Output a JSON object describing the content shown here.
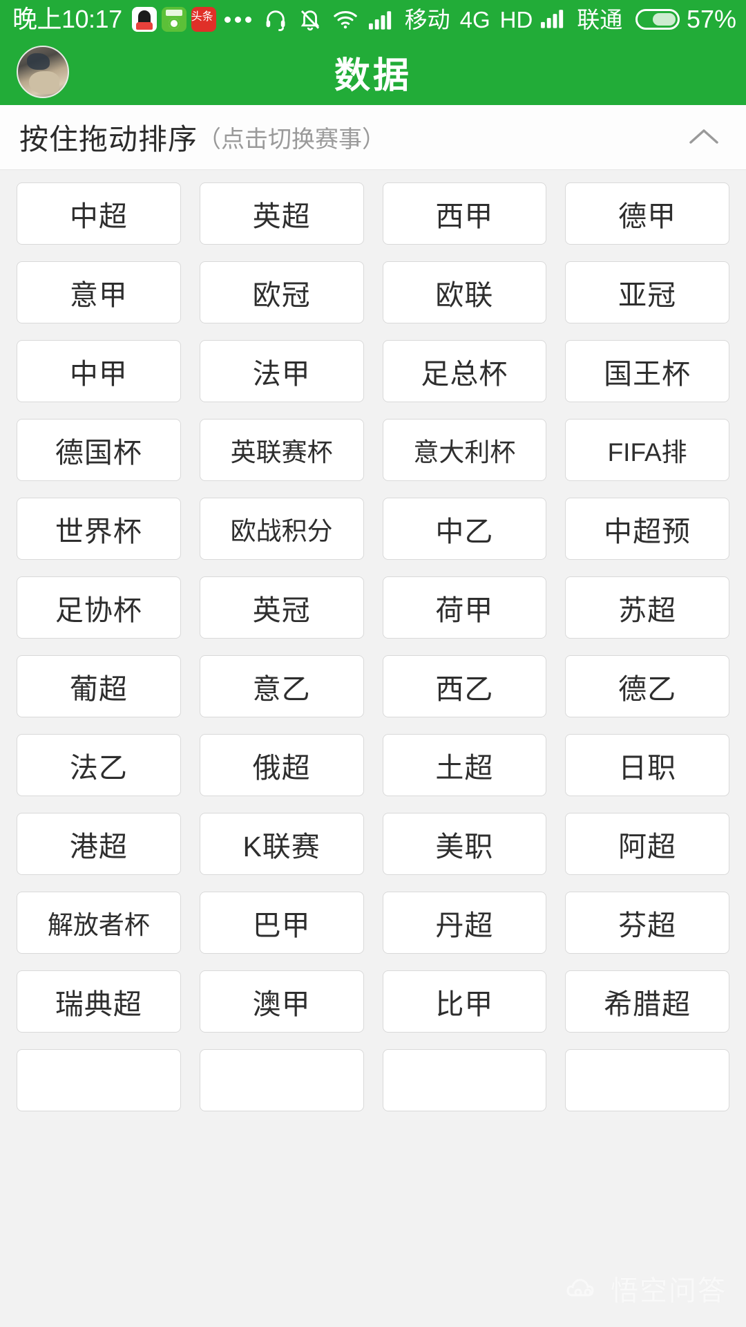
{
  "status_bar": {
    "clock": "晚上10:17",
    "app_icons": [
      {
        "name": "qq-icon",
        "label": ""
      },
      {
        "name": "football-app-icon",
        "label": ""
      },
      {
        "name": "toutiao-icon",
        "label": "头条"
      }
    ],
    "overflow_dots": "•••",
    "icons": [
      "headset-icon",
      "bell-muted-icon",
      "wifi-icon",
      "signal-bars-icon"
    ],
    "carrier_primary": "移动",
    "network_type": "4G",
    "hd_label": "HD",
    "carrier_secondary": "联通",
    "battery_percent": "57%"
  },
  "app_bar": {
    "title": "数据",
    "avatar_name": "user-avatar"
  },
  "hint_bar": {
    "main_text": "按住拖动排序",
    "sub_text": "（点击切换赛事）",
    "collapse_icon": "chevron-up-icon"
  },
  "leagues": [
    "中超",
    "英超",
    "西甲",
    "德甲",
    "意甲",
    "欧冠",
    "欧联",
    "亚冠",
    "中甲",
    "法甲",
    "足总杯",
    "国王杯",
    "德国杯",
    "英联赛杯",
    "意大利杯",
    "FIFA排",
    "世界杯",
    "欧战积分",
    "中乙",
    "中超预",
    "足协杯",
    "英冠",
    "荷甲",
    "苏超",
    "葡超",
    "意乙",
    "西乙",
    "德乙",
    "法乙",
    "俄超",
    "土超",
    "日职",
    "港超",
    "K联赛",
    "美职",
    "阿超",
    "解放者杯",
    "巴甲",
    "丹超",
    "芬超",
    "瑞典超",
    "澳甲",
    "比甲",
    "希腊超",
    "",
    "",
    "",
    ""
  ],
  "watermark": {
    "text": "悟空问答"
  },
  "colors": {
    "brand_green": "#22ac38",
    "page_background": "#f2f2f2",
    "card_background": "#ffffff",
    "card_border": "#d9d9d9",
    "text_primary": "#2e2e2e",
    "text_muted": "#9a9a9a"
  }
}
